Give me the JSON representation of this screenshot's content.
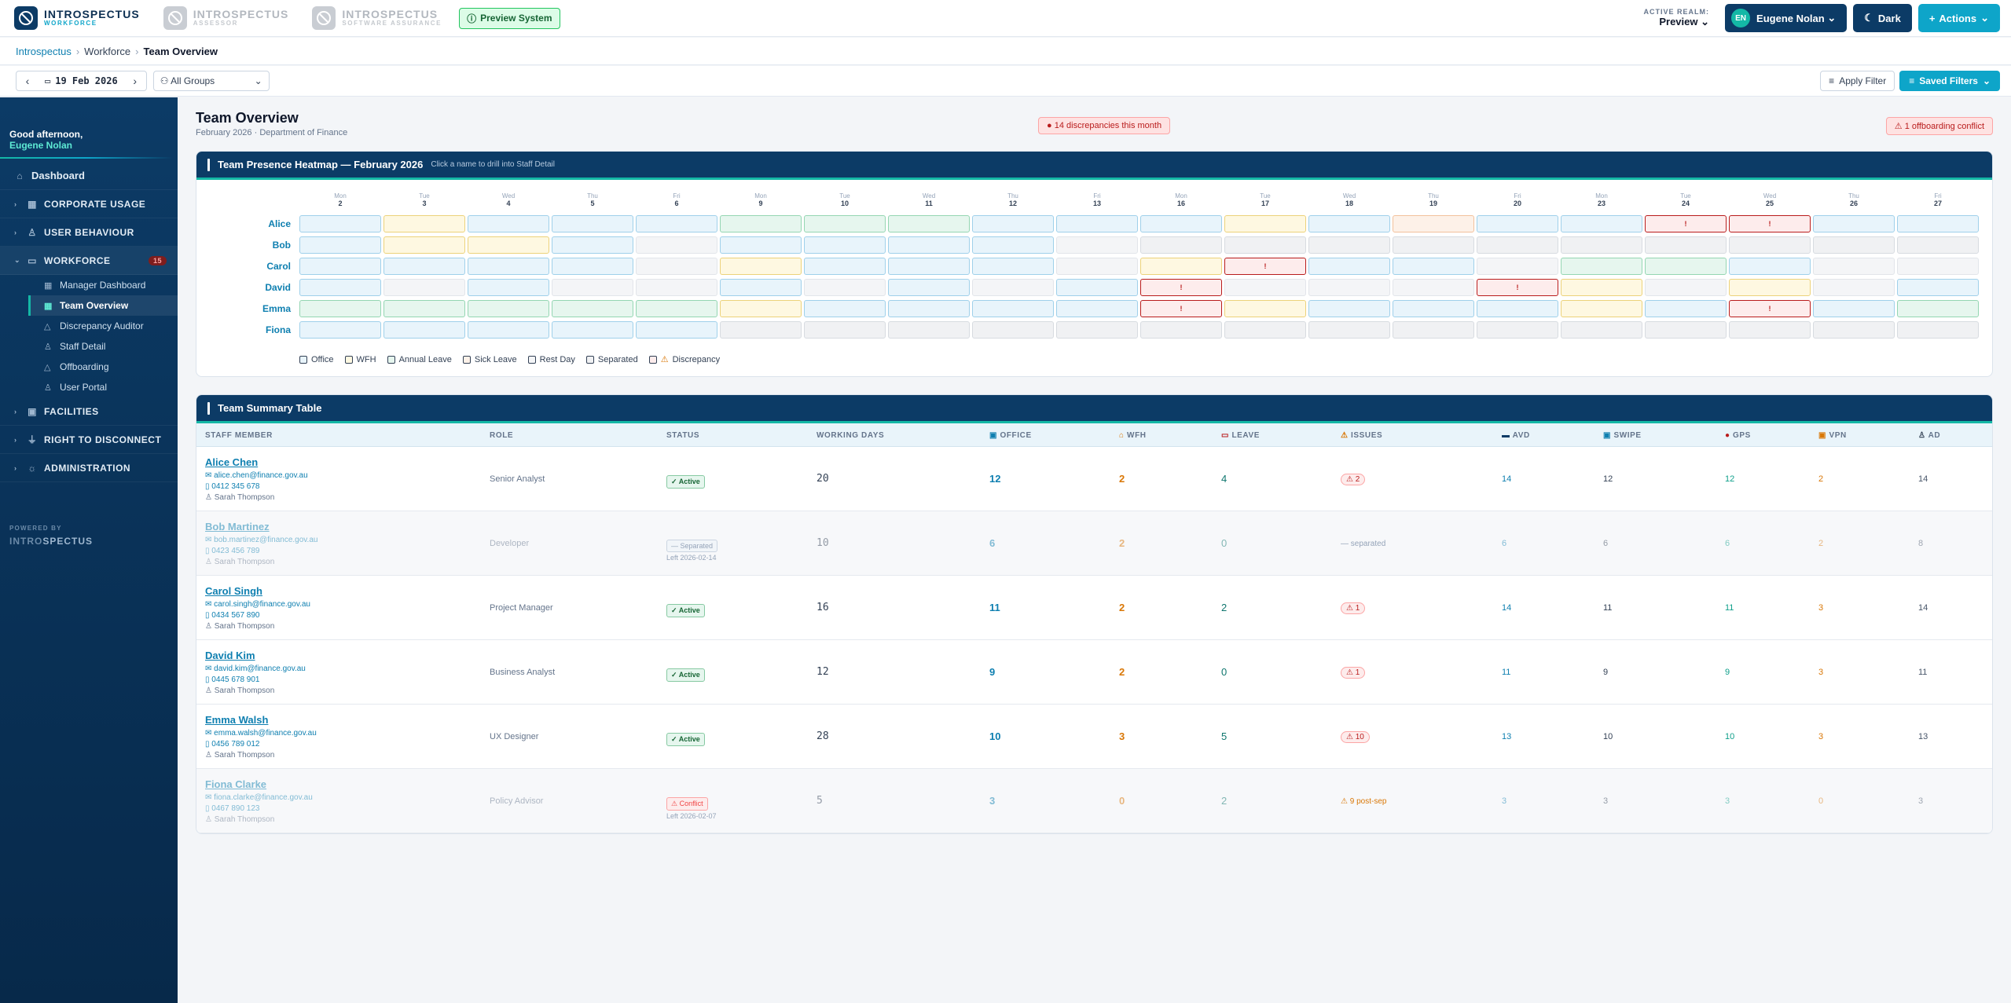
{
  "brands": [
    {
      "t1": "INTROSPECTUS",
      "t2": "WORKFORCE"
    },
    {
      "t1": "INTROSPECTUS",
      "t2": "ASSESSOR"
    },
    {
      "t1": "INTROSPECTUS",
      "t2": "SOFTWARE ASSURANCE"
    }
  ],
  "preview_badge": "Preview System",
  "realm": {
    "label": "ACTIVE REALM:",
    "value": "Preview"
  },
  "user": {
    "initials": "EN",
    "name": "Eugene Nolan"
  },
  "dark_label": "Dark",
  "actions_label": "Actions",
  "breadcrumb": [
    "Introspectus",
    "Workforce",
    "Team Overview"
  ],
  "toolbar": {
    "date": "19 Feb 2026",
    "groups": "All Groups",
    "apply": "Apply Filter",
    "saved": "Saved Filters"
  },
  "sidebar": {
    "greeting": "Good afternoon,",
    "user": "Eugene Nolan",
    "dashboard": "Dashboard",
    "sections": [
      {
        "label": "CORPORATE USAGE"
      },
      {
        "label": "USER BEHAVIOUR"
      },
      {
        "label": "WORKFORCE",
        "badge": "15"
      }
    ],
    "sub": [
      "Manager Dashboard",
      "Team Overview",
      "Discrepancy Auditor",
      "Staff Detail",
      "Offboarding",
      "User Portal"
    ],
    "more": [
      "FACILITIES",
      "RIGHT TO DISCONNECT",
      "ADMINISTRATION"
    ],
    "powered_by": "POWERED BY",
    "powered_a": "INTRO",
    "powered_b": "SPECTUS"
  },
  "page": {
    "title": "Team Overview",
    "subtitle": "February 2026 · Department of Finance",
    "discrepancies": "14 discrepancies this month",
    "offboarding": "1 offboarding conflict"
  },
  "heatmap": {
    "title": "Team Presence Heatmap — February 2026",
    "hint": "Click a name to drill into Staff Detail",
    "days": [
      {
        "d": "Mon",
        "n": "2"
      },
      {
        "d": "Tue",
        "n": "3"
      },
      {
        "d": "Wed",
        "n": "4"
      },
      {
        "d": "Thu",
        "n": "5"
      },
      {
        "d": "Fri",
        "n": "6"
      },
      {
        "d": "Mon",
        "n": "9"
      },
      {
        "d": "Tue",
        "n": "10"
      },
      {
        "d": "Wed",
        "n": "11"
      },
      {
        "d": "Thu",
        "n": "12"
      },
      {
        "d": "Fri",
        "n": "13"
      },
      {
        "d": "Mon",
        "n": "16"
      },
      {
        "d": "Tue",
        "n": "17"
      },
      {
        "d": "Wed",
        "n": "18"
      },
      {
        "d": "Thu",
        "n": "19"
      },
      {
        "d": "Fri",
        "n": "20"
      },
      {
        "d": "Mon",
        "n": "23"
      },
      {
        "d": "Tue",
        "n": "24"
      },
      {
        "d": "Wed",
        "n": "25"
      },
      {
        "d": "Thu",
        "n": "26"
      },
      {
        "d": "Fri",
        "n": "27"
      }
    ],
    "rows": [
      {
        "name": "Alice",
        "cells": "OWOOOAAAOOOWOSOODDOO"
      },
      {
        "name": "Bob",
        "cells": "OWWOROOOORXXXXXXXXXX"
      },
      {
        "name": "Carol",
        "cells": "OOOORWOOORWDOORAAORR"
      },
      {
        "name": "David",
        "cells": "ORORRORORODRRRDWRWRO"
      },
      {
        "name": "Emma",
        "cells": "AAAAAWOOOODWOOOWODOA"
      },
      {
        "name": "Fiona",
        "cells": "OOOOOXXXXXXXXXXXXXXX"
      }
    ],
    "discrepancy_mark": "!",
    "legend": [
      "Office",
      "WFH",
      "Annual Leave",
      "Sick Leave",
      "Rest Day",
      "Separated",
      "Discrepancy"
    ]
  },
  "summary": {
    "title": "Team Summary Table",
    "headers": [
      "STAFF MEMBER",
      "ROLE",
      "STATUS",
      "WORKING DAYS",
      "OFFICE",
      "WFH",
      "LEAVE",
      "ISSUES",
      "AVD",
      "SWIPE",
      "GPS",
      "VPN",
      "AD"
    ],
    "rows": [
      {
        "name": "Alice Chen",
        "email": "alice.chen@finance.gov.au",
        "phone": "0412 345 678",
        "mgr": "Sarah Thompson",
        "role": "Senior Analyst",
        "status": "✓ Active",
        "left": "",
        "wd": "20",
        "office": "12",
        "wfh": "2",
        "leave": "4",
        "issues": "⚠ 2",
        "avd": "14",
        "swipe": "12",
        "gps": "12",
        "vpn": "2",
        "ad": "14"
      },
      {
        "name": "Bob Martinez",
        "email": "bob.martinez@finance.gov.au",
        "phone": "0423 456 789",
        "mgr": "Sarah Thompson",
        "role": "Developer",
        "status": "— Separated",
        "left": "Left 2026-02-14",
        "wd": "10",
        "office": "6",
        "wfh": "2",
        "leave": "0",
        "issues": "— separated",
        "avd": "6",
        "swipe": "6",
        "gps": "6",
        "vpn": "2",
        "ad": "8"
      },
      {
        "name": "Carol Singh",
        "email": "carol.singh@finance.gov.au",
        "phone": "0434 567 890",
        "mgr": "Sarah Thompson",
        "role": "Project Manager",
        "status": "✓ Active",
        "left": "",
        "wd": "16",
        "office": "11",
        "wfh": "2",
        "leave": "2",
        "issues": "⚠ 1",
        "avd": "14",
        "swipe": "11",
        "gps": "11",
        "vpn": "3",
        "ad": "14"
      },
      {
        "name": "David Kim",
        "email": "david.kim@finance.gov.au",
        "phone": "0445 678 901",
        "mgr": "Sarah Thompson",
        "role": "Business Analyst",
        "status": "✓ Active",
        "left": "",
        "wd": "12",
        "office": "9",
        "wfh": "2",
        "leave": "0",
        "issues": "⚠ 1",
        "avd": "11",
        "swipe": "9",
        "gps": "9",
        "vpn": "3",
        "ad": "11"
      },
      {
        "name": "Emma Walsh",
        "email": "emma.walsh@finance.gov.au",
        "phone": "0456 789 012",
        "mgr": "Sarah Thompson",
        "role": "UX Designer",
        "status": "✓ Active",
        "left": "",
        "wd": "28",
        "office": "10",
        "wfh": "3",
        "leave": "5",
        "issues": "⚠ 10",
        "avd": "13",
        "swipe": "10",
        "gps": "10",
        "vpn": "3",
        "ad": "13"
      },
      {
        "name": "Fiona Clarke",
        "email": "fiona.clarke@finance.gov.au",
        "phone": "0467 890 123",
        "mgr": "Sarah Thompson",
        "role": "Policy Advisor",
        "status": "⚠ Conflict",
        "left": "Left 2026-02-07",
        "wd": "5",
        "office": "3",
        "wfh": "0",
        "leave": "2",
        "issues": "⚠ 9 post-sep",
        "avd": "3",
        "swipe": "3",
        "gps": "3",
        "vpn": "0",
        "ad": "3"
      }
    ]
  }
}
